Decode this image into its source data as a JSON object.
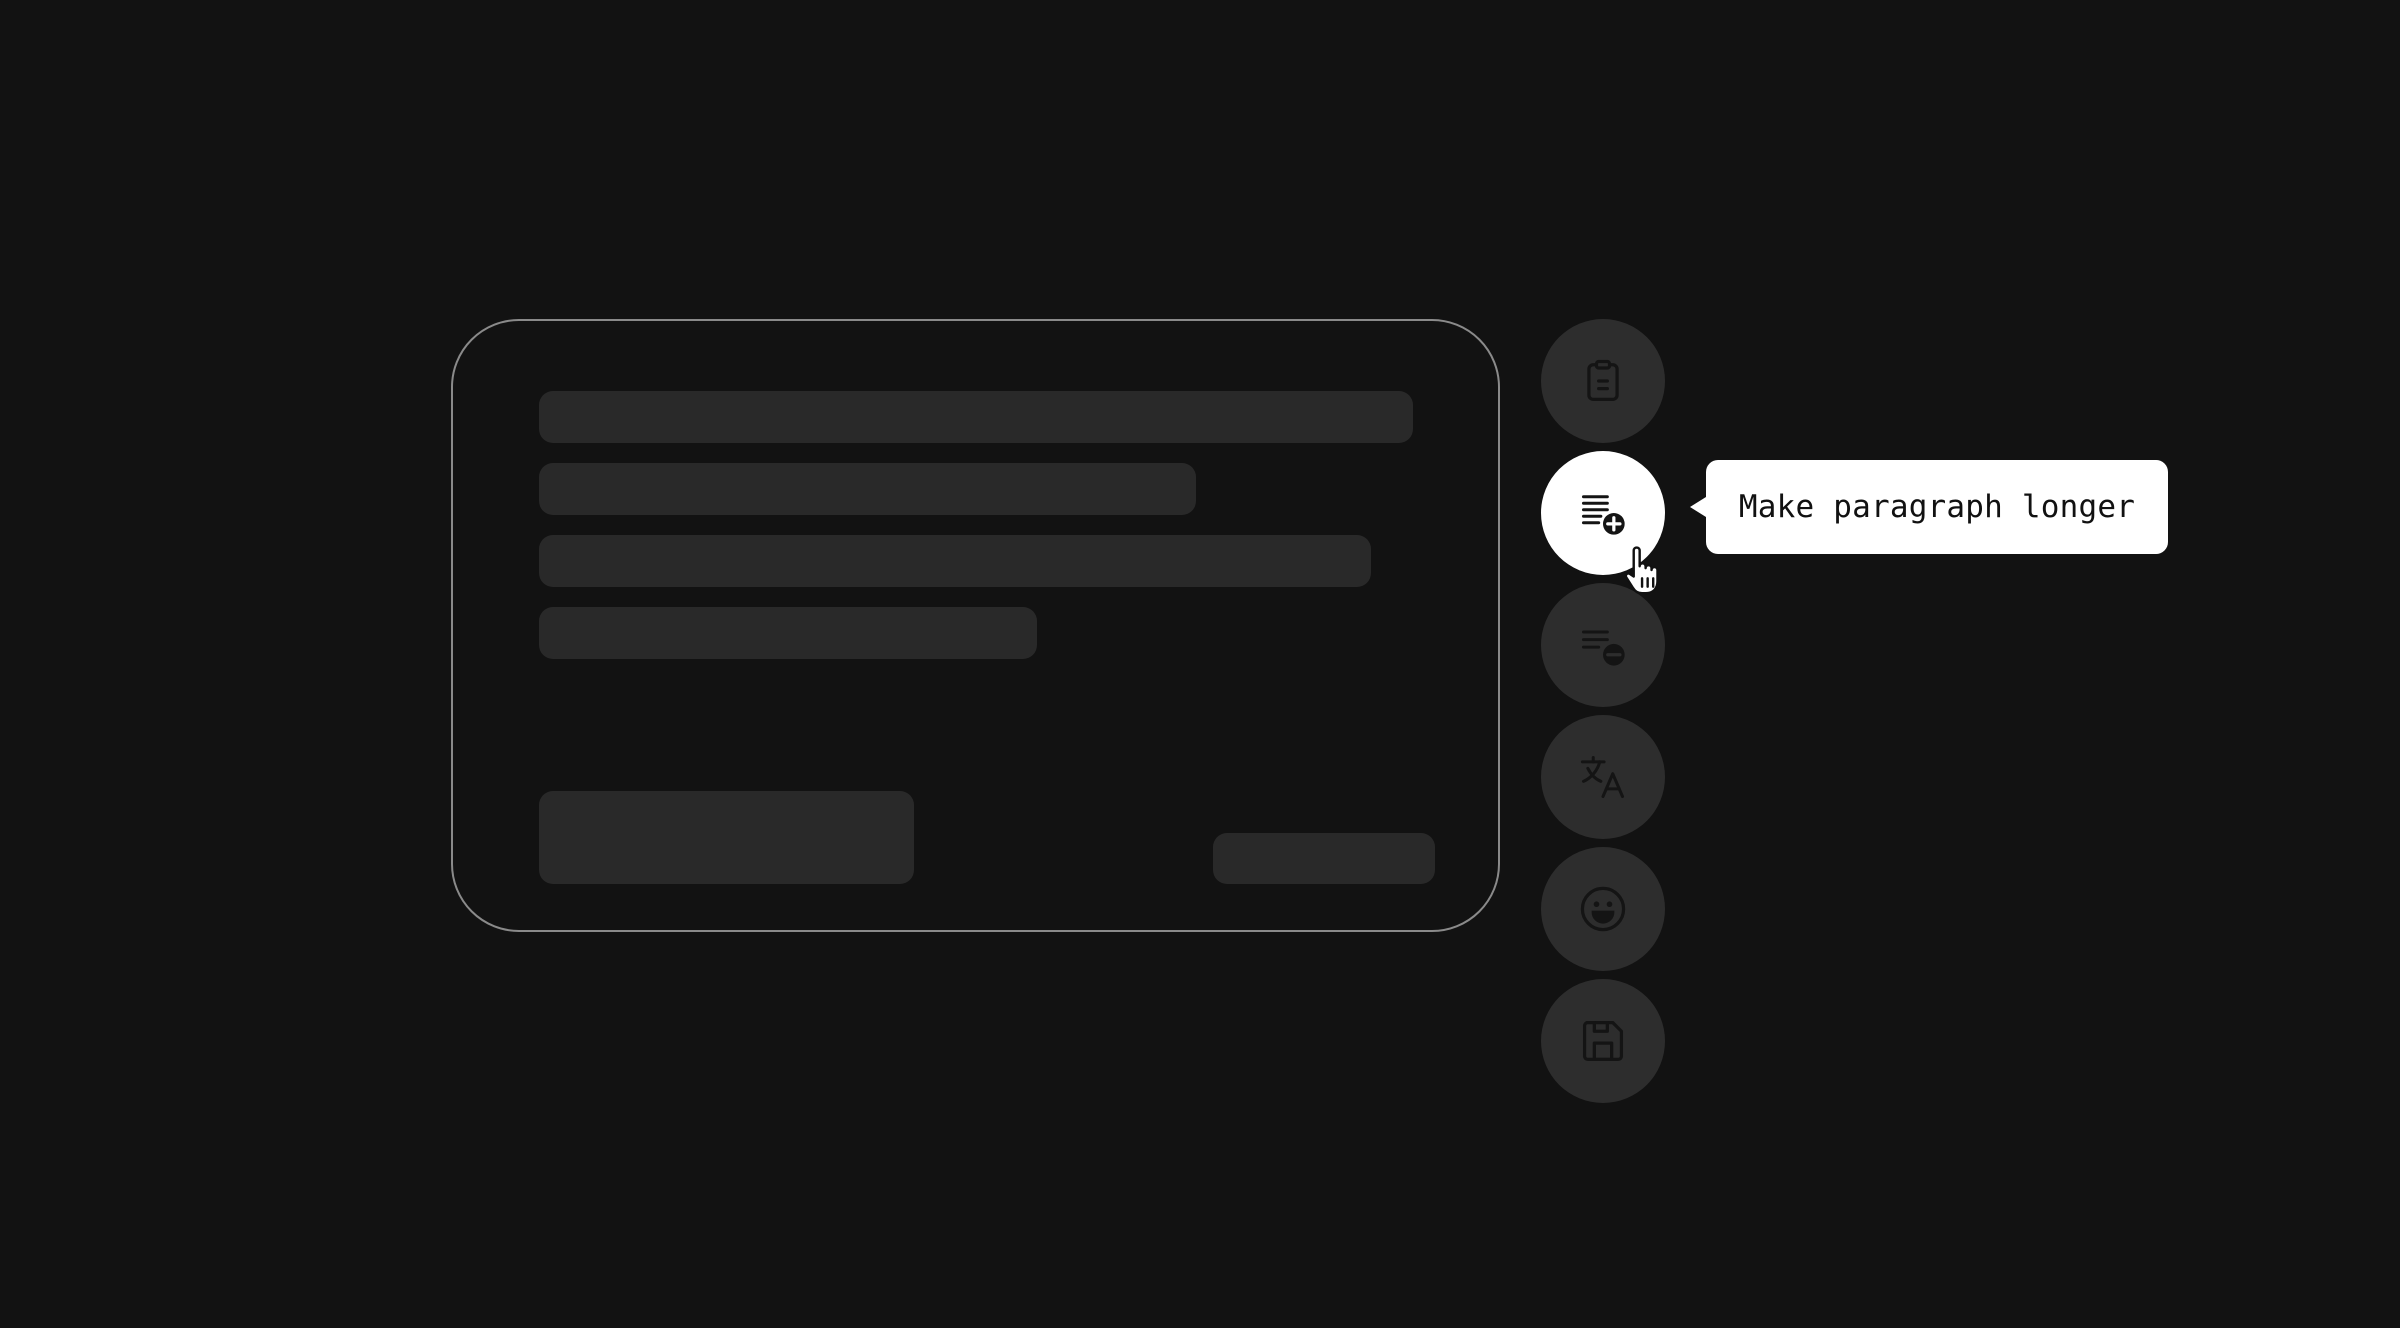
{
  "canvas": {
    "background": "#121212"
  },
  "editor_card": {
    "placeholder_color": "#292929",
    "border_color": "#8a8a8a"
  },
  "toolbar": {
    "buttons": [
      {
        "name": "clipboard-button",
        "icon": "clipboard-icon",
        "active": false
      },
      {
        "name": "make-paragraph-longer-button",
        "icon": "lines-plus-icon",
        "active": true
      },
      {
        "name": "make-paragraph-shorter-button",
        "icon": "lines-minus-icon",
        "active": false
      },
      {
        "name": "translate-button",
        "icon": "translate-icon",
        "active": false
      },
      {
        "name": "emoji-button",
        "icon": "smiley-icon",
        "active": false
      },
      {
        "name": "save-button",
        "icon": "floppy-disk-icon",
        "active": false
      }
    ],
    "inactive_color": "#2d2d2d",
    "active_color": "#ffffff"
  },
  "tooltip": {
    "text": "Make paragraph longer"
  },
  "cursor": {
    "icon": "hand-pointer-icon"
  }
}
